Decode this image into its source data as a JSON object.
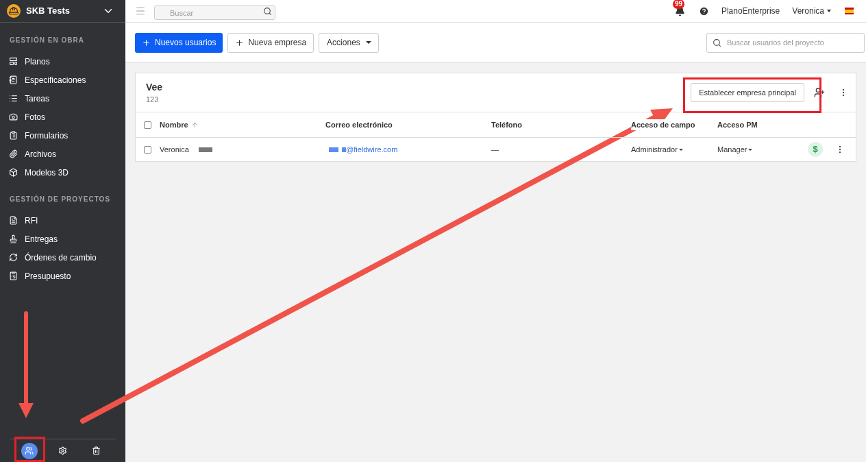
{
  "sidebar": {
    "project": "SKB Tests",
    "sections": [
      {
        "title": "GESTIÓN EN OBRA",
        "items": [
          {
            "label": "Planos"
          },
          {
            "label": "Especificaciones"
          },
          {
            "label": "Tareas"
          },
          {
            "label": "Fotos"
          },
          {
            "label": "Formularios"
          },
          {
            "label": "Archivos"
          },
          {
            "label": "Modelos 3D"
          }
        ]
      },
      {
        "title": "GESTIÓN DE PROYECTOS",
        "items": [
          {
            "label": "RFI"
          },
          {
            "label": "Entregas"
          },
          {
            "label": "Órdenes de cambio"
          },
          {
            "label": "Presupuesto"
          }
        ]
      }
    ],
    "footer_tabs": [
      {
        "selected": true
      },
      {
        "selected": false
      },
      {
        "selected": false
      }
    ]
  },
  "header": {
    "search": {
      "placeholder": "Buscar"
    },
    "notifications": "99",
    "organization": "PlanoEnterprise",
    "user": "Veronica"
  },
  "toolbar": {
    "buttons": [
      {
        "label": "Nuevos usuarios",
        "kind": "primary"
      },
      {
        "label": "Nueva empresa",
        "kind": "add"
      },
      {
        "label": "Acciones",
        "kind": "dropdown"
      }
    ],
    "search": {
      "placeholder": "Buscar usuarios del proyecto"
    }
  },
  "company": {
    "name": "Vee",
    "subtitle": "123",
    "action": "Establecer empresa principal",
    "table": {
      "select_all_checked": false,
      "columns": [
        "Nombre",
        "Correo electrónico",
        "Teléfono",
        "Acceso de campo",
        "Acceso PM"
      ],
      "rows": [
        {
          "checked": false,
          "name": "Veronica",
          "email": "@fieldwire.com",
          "phone": "—",
          "field_access": "Administrador",
          "pm_access": "Manager",
          "badge": "$"
        }
      ]
    }
  }
}
